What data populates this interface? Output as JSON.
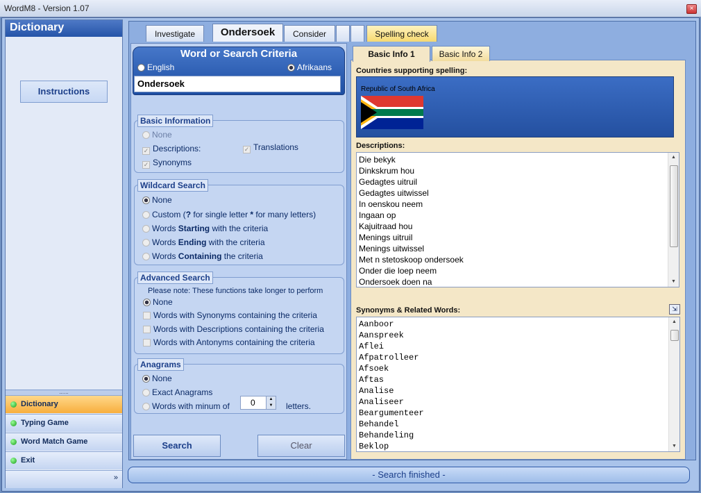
{
  "window": {
    "title": "WordM8 - Version 1.07",
    "close": "×"
  },
  "sidebar": {
    "header": "Dictionary",
    "instructions": "Instructions",
    "grip": "......",
    "nav": [
      {
        "label": "Dictionary"
      },
      {
        "label": "Typing Game"
      },
      {
        "label": "Word Match Game"
      },
      {
        "label": "Exit"
      }
    ],
    "more": "»"
  },
  "tabs": {
    "t1": "Investigate",
    "t2": "Ondersoek",
    "t3": "Consider",
    "t4": "",
    "t5": "",
    "t6": "Spelling check"
  },
  "search": {
    "title": "Word or Search Criteria",
    "english": "English",
    "afrikaans": "Afrikaans",
    "value": "Ondersoek"
  },
  "basic": {
    "title": "Basic Information",
    "none": "None",
    "descriptions": "Descriptions:",
    "synonyms": "Synonyms",
    "translations": "Translations"
  },
  "wildcard": {
    "title": "Wildcard Search",
    "none": "None",
    "custom_a": "Custom (",
    "custom_q": "?",
    "custom_b": " for single letter ",
    "custom_star": "*",
    "custom_c": " for many letters)",
    "start_a": "Words ",
    "start_b": "Starting",
    "start_c": " with the criteria",
    "end_a": "Words ",
    "end_b": "Ending",
    "end_c": " with the criteria",
    "cont_a": "Words ",
    "cont_b": "Containing",
    "cont_c": " the criteria"
  },
  "advanced": {
    "title": "Advanced Search",
    "note": "Please note: These functions take longer to perform",
    "none": "None",
    "syn": "Words with Synonyms containing the criteria",
    "desc": "Words with Descriptions containing the criteria",
    "ant": "Words with Antonyms containing the criteria"
  },
  "anagrams": {
    "title": "Anagrams",
    "none": "None",
    "exact": "Exact Anagrams",
    "minimum": "Words with minum of",
    "min_value": "0",
    "letters": "letters."
  },
  "buttons": {
    "search": "Search",
    "clear": "Clear"
  },
  "right": {
    "tab1": "Basic Info 1",
    "tab2": "Basic Info 2",
    "countries_label": "Countries supporting spelling:",
    "country": "Republic of South Africa",
    "descriptions_label": "Descriptions:",
    "descriptions": [
      "Die bekyk",
      "Dinkskrum hou",
      "Gedagtes uitruil",
      "Gedagtes uitwissel",
      "In oenskou neem",
      "Ingaan op",
      "Kajuitraad hou",
      "Menings uitruil",
      "Menings uitwissel",
      "Met n stetoskoop ondersoek",
      "Onder die loep neem",
      "Ondersoek doen na"
    ],
    "synonyms_label": "Synonyms & Related Words:",
    "synonyms": [
      "Aanboor",
      "Aanspreek",
      "Aflei",
      "Afpatrolleer",
      "Afsoek",
      "Aftas",
      "Analise",
      "Analiseer",
      "Beargumenteer",
      "Behandel",
      "Behandeling",
      "Beklop"
    ]
  },
  "status": "- Search finished -",
  "colors": {
    "accent": "#2554a8",
    "active_nav": "#f7ae3d",
    "panel": "#f4e7c7"
  }
}
